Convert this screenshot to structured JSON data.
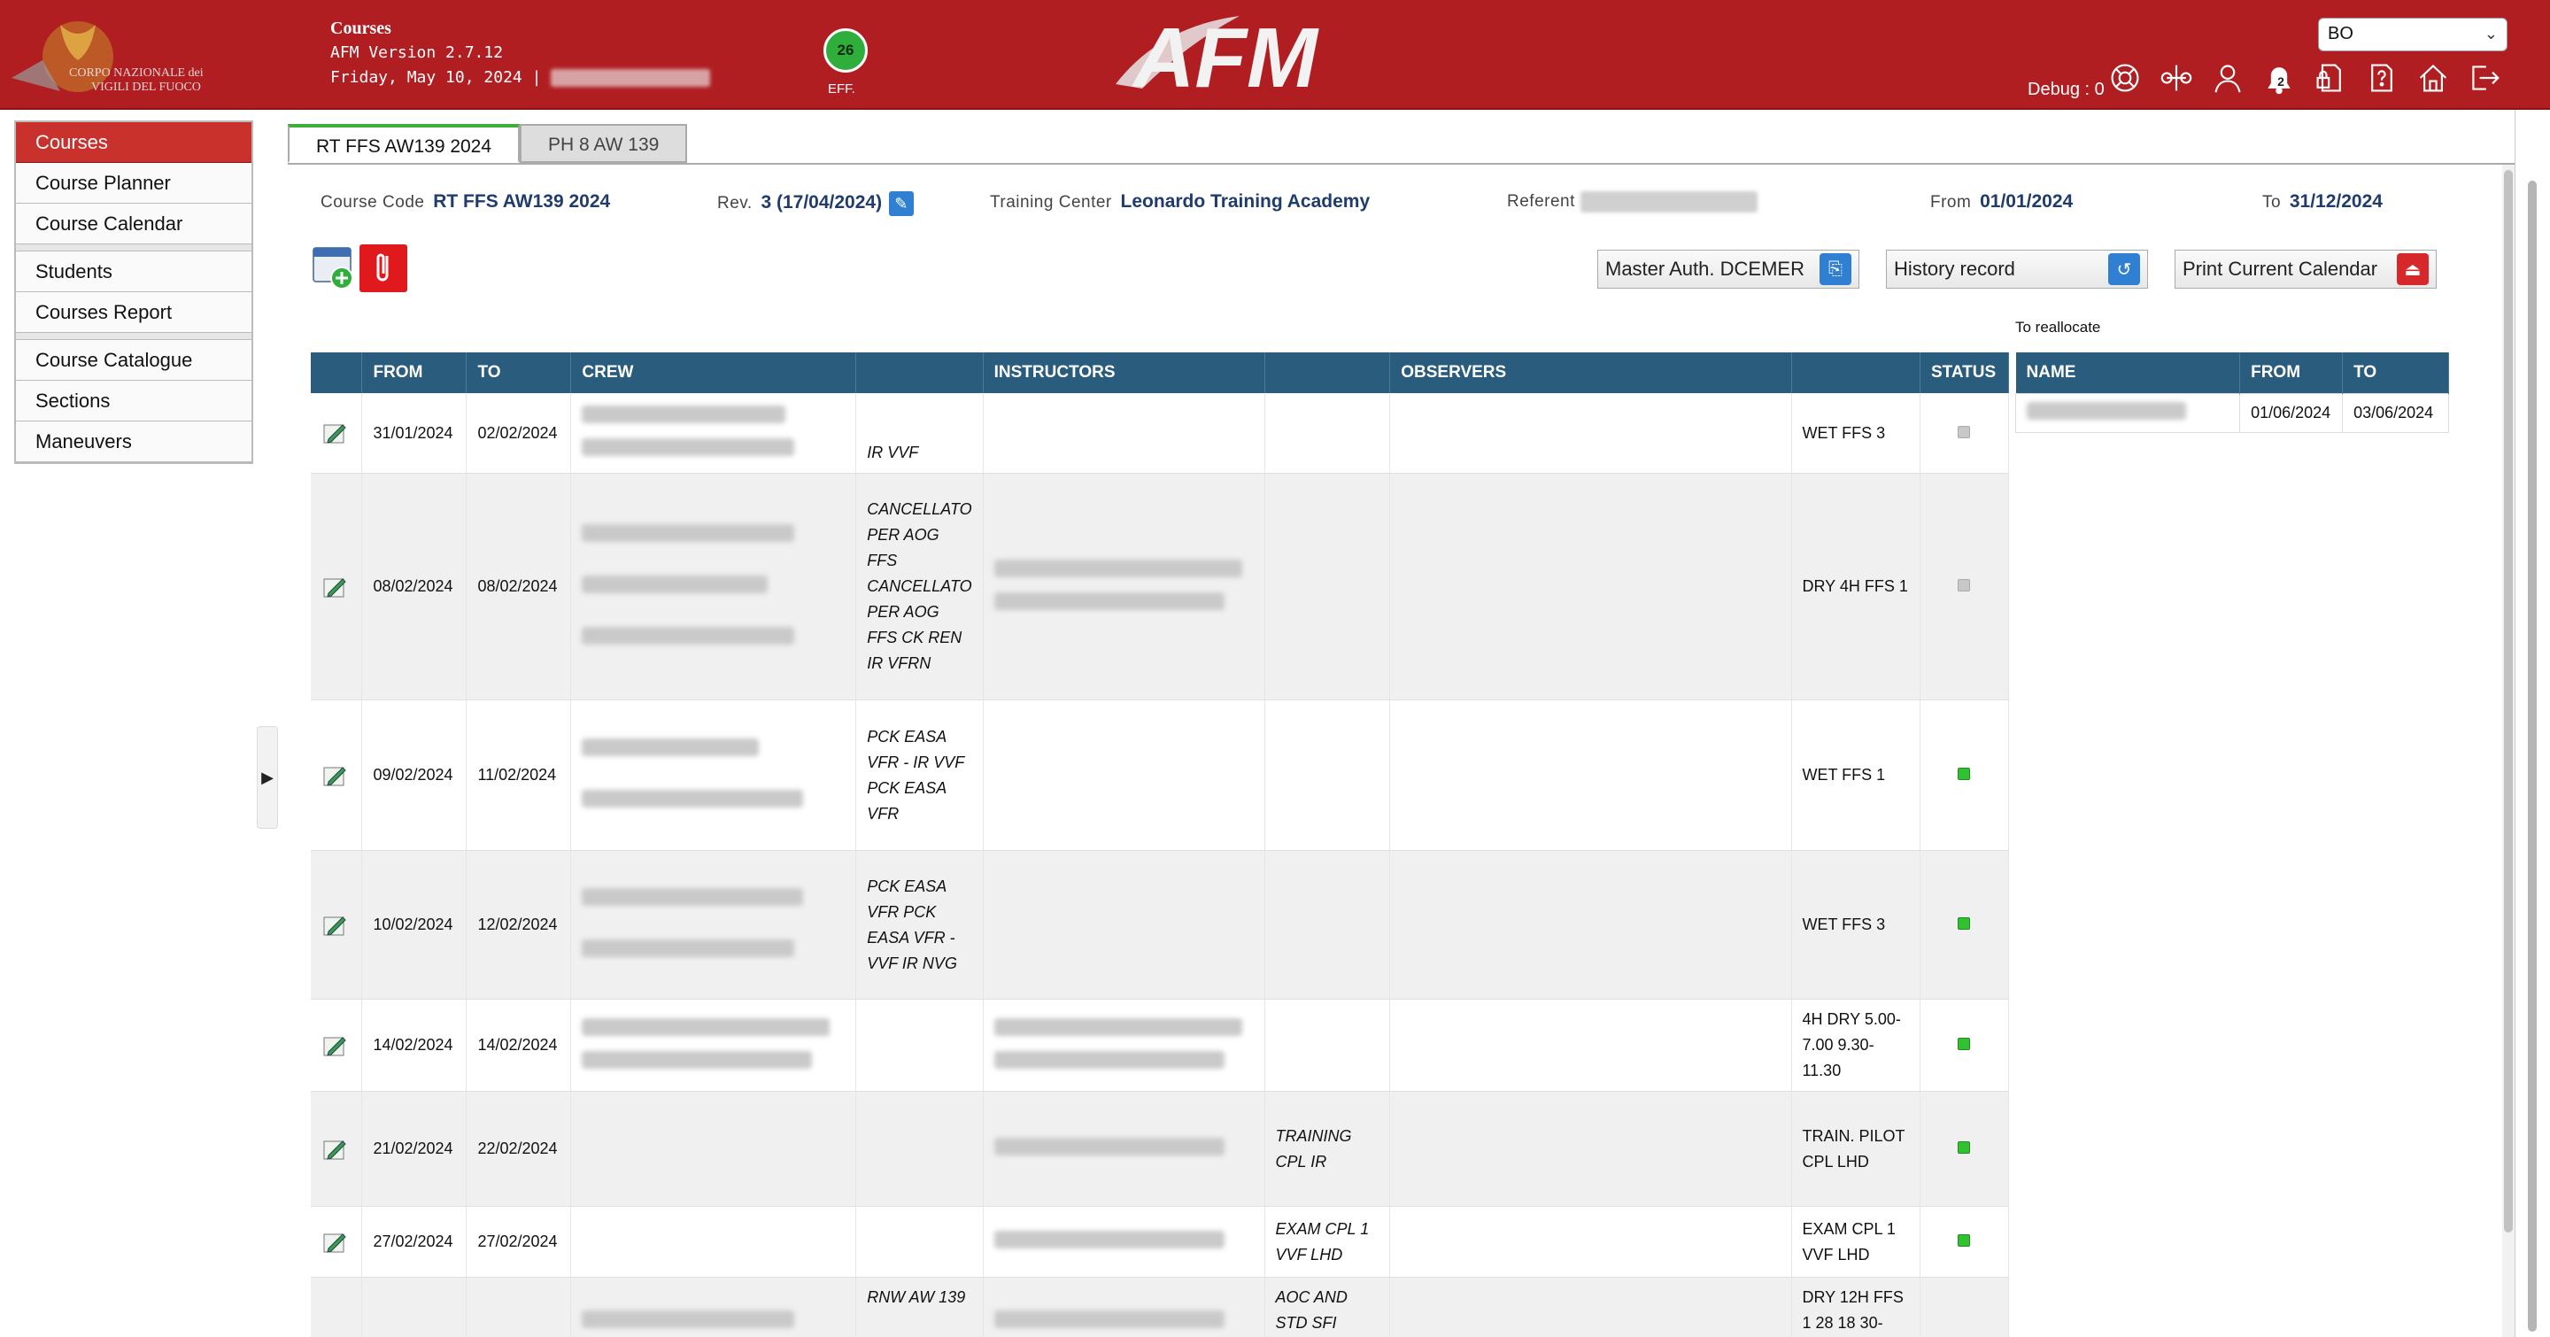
{
  "header": {
    "logo_text_line1": "CORPO NAZIONALE dei",
    "logo_text_line2": "VIGILI DEL FUOCO",
    "title": "Courses",
    "version": "AFM Version 2.7.12",
    "date": "Friday, May 10, 2024 |",
    "eff_count": "26",
    "eff_label": "EFF.",
    "brand": "AFM",
    "base_select": "BO",
    "debug": "Debug : 0",
    "notifications_count": "2",
    "icons": [
      "lifebuoy-icon",
      "balance-icon",
      "user-icon",
      "bell-icon",
      "document-lock-icon",
      "help-icon",
      "home-icon",
      "logout-icon"
    ]
  },
  "sidebar": {
    "items": [
      {
        "label": "Courses",
        "active": true
      },
      {
        "label": "Course Planner"
      },
      {
        "label": "Course Calendar"
      },
      {
        "label": "Students"
      },
      {
        "label": "Courses Report"
      },
      {
        "label": "Course Catalogue"
      },
      {
        "label": "Sections"
      },
      {
        "label": "Maneuvers"
      }
    ]
  },
  "tabs": [
    {
      "label": "RT FFS AW139 2024",
      "active": true
    },
    {
      "label": "PH 8 AW 139"
    }
  ],
  "course_info": {
    "code_label": "Course Code",
    "code": "RT FFS AW139 2024",
    "rev_label": "Rev.",
    "rev": "3 (17/04/2024)",
    "center_label": "Training Center",
    "center": "Leonardo Training Academy",
    "referent_label": "Referent",
    "from_label": "From",
    "from": "01/01/2024",
    "to_label": "To",
    "to": "31/12/2024"
  },
  "actions": {
    "master_auth": "Master Auth. DCEMER",
    "history": "History record",
    "print": "Print Current Calendar"
  },
  "table": {
    "headers": [
      "",
      "FROM",
      "TO",
      "CREW",
      "",
      "INSTRUCTORS",
      "",
      "OBSERVERS",
      "",
      "STATUS"
    ],
    "rows": [
      {
        "from": "31/01/2024",
        "to": "02/02/2024",
        "crew_notes": "IR VVF",
        "inst_notes": "",
        "obs_notes": "",
        "type": "WET FFS 3",
        "status": "grey"
      },
      {
        "from": "08/02/2024",
        "to": "08/02/2024",
        "crew_notes": "CANCELLATO PER AOG FFS CANCELLATO PER AOG FFS CK REN IR VFRN",
        "inst_notes": "",
        "obs_notes": "",
        "type": "DRY 4H FFS 1",
        "status": "grey"
      },
      {
        "from": "09/02/2024",
        "to": "11/02/2024",
        "crew_notes": "PCK EASA VFR - IR VVF PCK EASA VFR",
        "inst_notes": "",
        "obs_notes": "",
        "type": "WET FFS 1",
        "status": "green"
      },
      {
        "from": "10/02/2024",
        "to": "12/02/2024",
        "crew_notes": "PCK EASA VFR PCK EASA VFR - VVF IR NVG",
        "inst_notes": "",
        "obs_notes": "",
        "type": "WET FFS 3",
        "status": "green"
      },
      {
        "from": "14/02/2024",
        "to": "14/02/2024",
        "crew_notes": "",
        "inst_notes": "",
        "obs_notes": "",
        "type": "4H DRY 5.00-7.00 9.30-11.30",
        "status": "green"
      },
      {
        "from": "21/02/2024",
        "to": "22/02/2024",
        "crew_notes": "",
        "inst_notes": "TRAINING CPL IR",
        "obs_notes": "",
        "type": "TRAIN. PILOT CPL LHD",
        "status": "green"
      },
      {
        "from": "27/02/2024",
        "to": "27/02/2024",
        "crew_notes": "",
        "inst_notes": "EXAM CPL 1 VVF LHD",
        "obs_notes": "",
        "type": "EXAM CPL 1 VVF LHD",
        "status": "green"
      },
      {
        "from": "",
        "to": "",
        "crew_notes": "RNW AW 139",
        "inst_notes": "AOC AND STD SFI",
        "obs_notes": "",
        "type": "DRY 12H FFS 1 28 18 30-",
        "status": ""
      }
    ]
  },
  "reallocate": {
    "title": "To reallocate",
    "headers": [
      "NAME",
      "FROM",
      "TO"
    ],
    "rows": [
      {
        "from": "01/06/2024",
        "to": "03/06/2024"
      }
    ]
  }
}
